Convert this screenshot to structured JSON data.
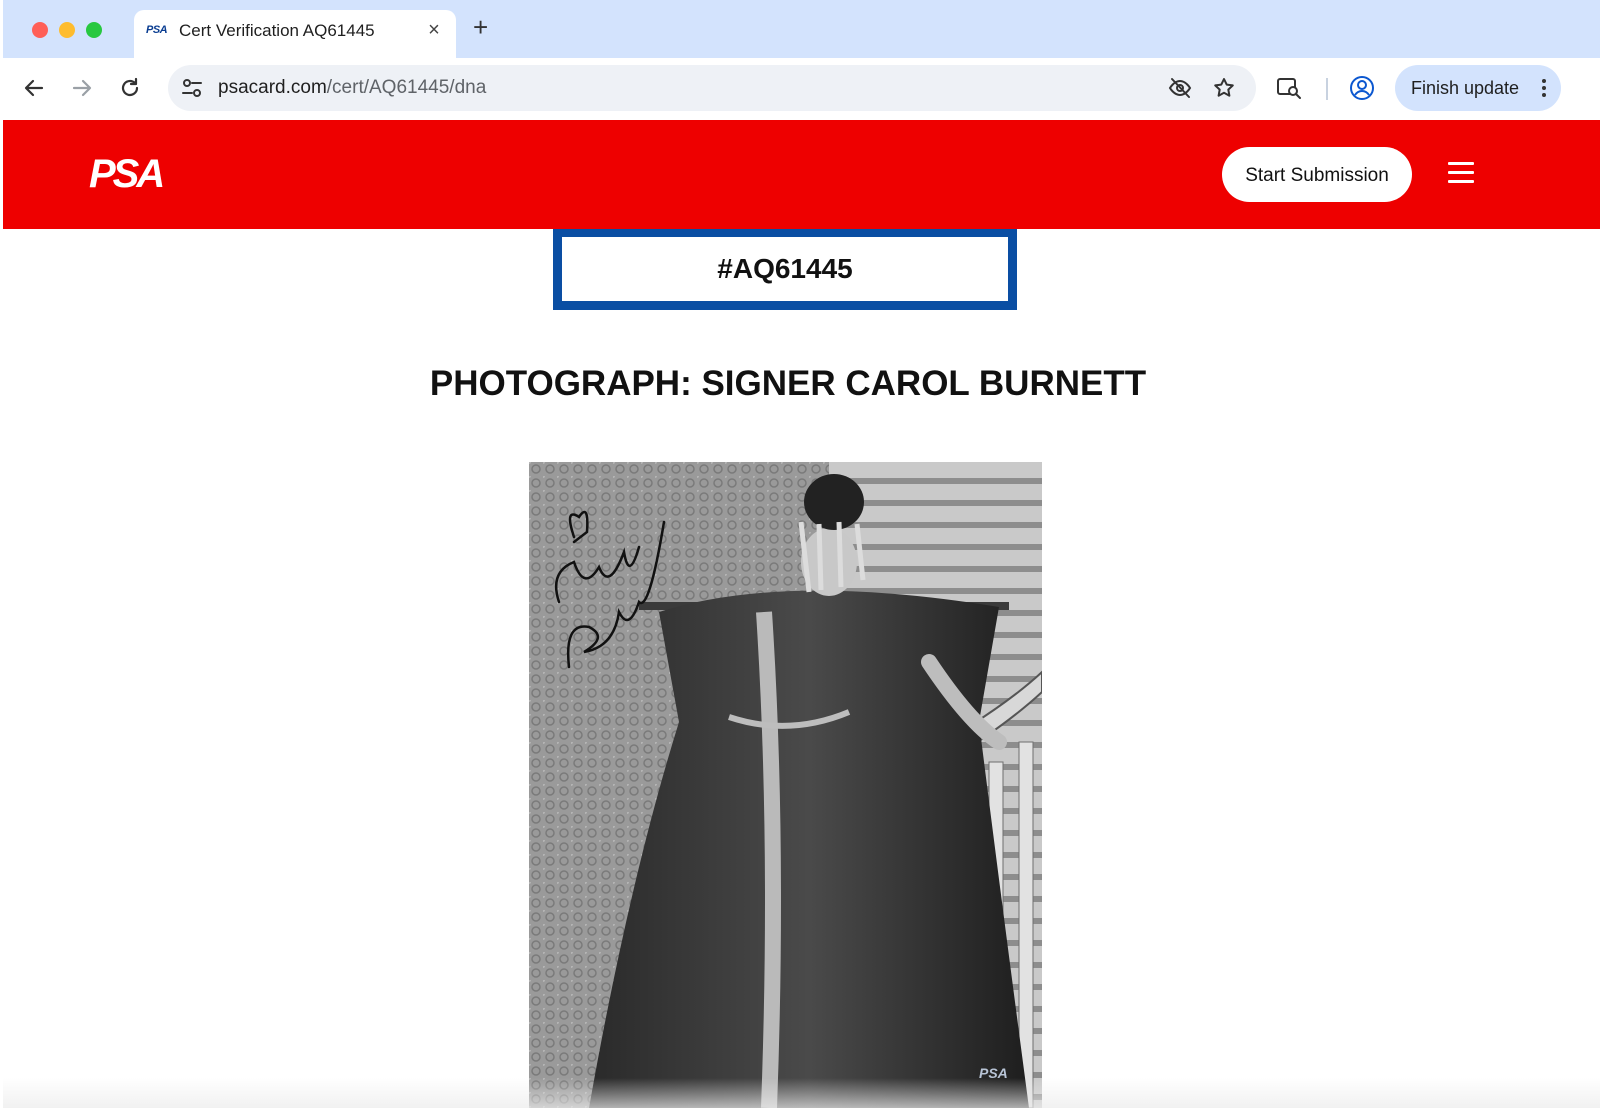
{
  "browser": {
    "tab": {
      "favicon_text": "PSA",
      "title": "Cert Verification AQ61445",
      "close_label": "×"
    },
    "new_tab_label": "+",
    "url": {
      "host": "psacard.com",
      "path": "/cert/AQ61445/dna"
    },
    "finish_update_label": "Finish update",
    "icons": [
      "back-icon",
      "forward-icon",
      "reload-icon",
      "site-info-icon",
      "eye-off-icon",
      "star-icon",
      "lens-search-icon",
      "profile-icon",
      "more-vert-icon"
    ]
  },
  "site": {
    "logo": "PSA",
    "start_submission_label": "Start Submission",
    "menu_icon": "hamburger-menu-icon",
    "colors": {
      "header": "#ee0000",
      "cert_border": "#0a4ea3"
    }
  },
  "cert": {
    "number": "#AQ61445",
    "title": "PHOTOGRAPH: SIGNER CAROL BURNETT"
  }
}
